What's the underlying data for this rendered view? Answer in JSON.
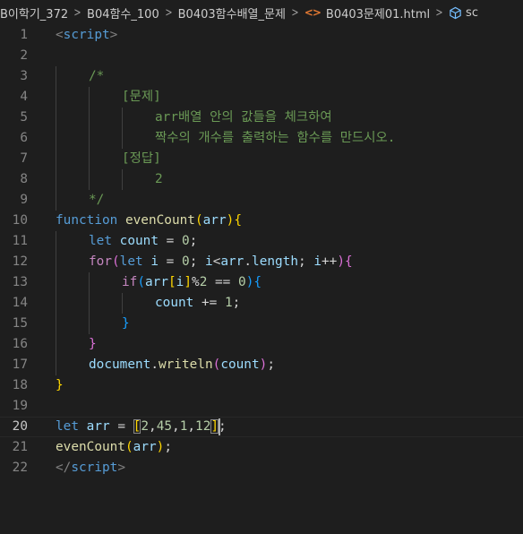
{
  "breadcrumb": [
    {
      "label": "B이학기_372",
      "icon": null
    },
    {
      "label": "B04함수_100",
      "icon": null
    },
    {
      "label": "B0403함수배열_문제",
      "icon": null
    },
    {
      "label": "B0403문제01.html",
      "icon": "html-icon",
      "icon_glyph": "<>"
    },
    {
      "label": "sc",
      "icon": "symbol-cube-icon"
    }
  ],
  "editor": {
    "current_line": 20,
    "lines": [
      {
        "n": 1,
        "indent": 0,
        "tokens": [
          [
            "tag",
            "<"
          ],
          [
            "tagname",
            "script"
          ],
          [
            "tag",
            ">"
          ]
        ]
      },
      {
        "n": 2,
        "indent": 0,
        "tokens": []
      },
      {
        "n": 3,
        "indent": 1,
        "tokens": [
          [
            "comment",
            "/*"
          ]
        ]
      },
      {
        "n": 4,
        "indent": 2,
        "tokens": [
          [
            "comment",
            "[문제]"
          ]
        ]
      },
      {
        "n": 5,
        "indent": 3,
        "tokens": [
          [
            "comment",
            "arr배열 안의 값들을 체크하여"
          ]
        ]
      },
      {
        "n": 6,
        "indent": 3,
        "tokens": [
          [
            "comment",
            "짝수의 개수를 출력하는 함수를 만드시오."
          ]
        ]
      },
      {
        "n": 7,
        "indent": 2,
        "tokens": [
          [
            "comment",
            "[정답]"
          ]
        ]
      },
      {
        "n": 8,
        "indent": 3,
        "tokens": [
          [
            "comment",
            "2"
          ]
        ]
      },
      {
        "n": 9,
        "indent": 1,
        "tokens": [
          [
            "comment",
            "*/"
          ]
        ]
      },
      {
        "n": 10,
        "indent": 0,
        "tokens": [
          [
            "kw",
            "function"
          ],
          [
            "op",
            " "
          ],
          [
            "fn",
            "evenCount"
          ],
          [
            "b1",
            "("
          ],
          [
            "var",
            "arr"
          ],
          [
            "b1",
            ")"
          ],
          [
            "b1",
            "{"
          ]
        ]
      },
      {
        "n": 11,
        "indent": 1,
        "tokens": [
          [
            "kw",
            "let"
          ],
          [
            "op",
            " "
          ],
          [
            "var",
            "count"
          ],
          [
            "op",
            " = "
          ],
          [
            "num",
            "0"
          ],
          [
            "op",
            ";"
          ]
        ]
      },
      {
        "n": 12,
        "indent": 1,
        "tokens": [
          [
            "ctrl",
            "for"
          ],
          [
            "b2",
            "("
          ],
          [
            "kw",
            "let"
          ],
          [
            "op",
            " "
          ],
          [
            "var",
            "i"
          ],
          [
            "op",
            " = "
          ],
          [
            "num",
            "0"
          ],
          [
            "op",
            "; "
          ],
          [
            "var",
            "i"
          ],
          [
            "op",
            "<"
          ],
          [
            "var",
            "arr"
          ],
          [
            "op",
            "."
          ],
          [
            "var",
            "length"
          ],
          [
            "op",
            "; "
          ],
          [
            "var",
            "i"
          ],
          [
            "op",
            "++"
          ],
          [
            "b2",
            ")"
          ],
          [
            "b2",
            "{"
          ]
        ]
      },
      {
        "n": 13,
        "indent": 2,
        "tokens": [
          [
            "ctrl",
            "if"
          ],
          [
            "b3",
            "("
          ],
          [
            "var",
            "arr"
          ],
          [
            "b1",
            "["
          ],
          [
            "var",
            "i"
          ],
          [
            "b1",
            "]"
          ],
          [
            "op",
            "%"
          ],
          [
            "num",
            "2"
          ],
          [
            "op",
            " == "
          ],
          [
            "num",
            "0"
          ],
          [
            "b3",
            ")"
          ],
          [
            "b3",
            "{"
          ]
        ]
      },
      {
        "n": 14,
        "indent": 3,
        "tokens": [
          [
            "var",
            "count"
          ],
          [
            "op",
            " += "
          ],
          [
            "num",
            "1"
          ],
          [
            "op",
            ";"
          ]
        ]
      },
      {
        "n": 15,
        "indent": 2,
        "tokens": [
          [
            "b3",
            "}"
          ]
        ]
      },
      {
        "n": 16,
        "indent": 1,
        "tokens": [
          [
            "b2",
            "}"
          ]
        ]
      },
      {
        "n": 17,
        "indent": 1,
        "tokens": [
          [
            "var",
            "document"
          ],
          [
            "op",
            "."
          ],
          [
            "fn",
            "writeln"
          ],
          [
            "b2",
            "("
          ],
          [
            "var",
            "count"
          ],
          [
            "b2",
            ")"
          ],
          [
            "op",
            ";"
          ]
        ]
      },
      {
        "n": 18,
        "indent": 0,
        "tokens": [
          [
            "b1",
            "}"
          ]
        ]
      },
      {
        "n": 19,
        "indent": 0,
        "tokens": []
      },
      {
        "n": 20,
        "indent": 0,
        "tokens": [
          [
            "kw",
            "let"
          ],
          [
            "op",
            " "
          ],
          [
            "var",
            "arr"
          ],
          [
            "op",
            " = "
          ],
          [
            "bm",
            "["
          ],
          [
            "num",
            "2"
          ],
          [
            "op",
            ","
          ],
          [
            "num",
            "45"
          ],
          [
            "op",
            ","
          ],
          [
            "num",
            "1"
          ],
          [
            "op",
            ","
          ],
          [
            "num",
            "12"
          ],
          [
            "bm",
            "]"
          ],
          [
            "op",
            ";"
          ]
        ]
      },
      {
        "n": 21,
        "indent": 0,
        "tokens": [
          [
            "fn",
            "evenCount"
          ],
          [
            "b1",
            "("
          ],
          [
            "var",
            "arr"
          ],
          [
            "b1",
            ")"
          ],
          [
            "op",
            ";"
          ]
        ]
      },
      {
        "n": 22,
        "indent": 0,
        "tokens": [
          [
            "tag",
            "</"
          ],
          [
            "tagname",
            "script"
          ],
          [
            "tag",
            ">"
          ]
        ]
      }
    ]
  },
  "colors": {
    "background": "#1e1e1e",
    "line_number": "#858585",
    "comment": "#6a9955",
    "keyword": "#569cd6",
    "control": "#c586c0",
    "function": "#dcdcaa",
    "variable": "#9cdcfe",
    "number": "#b5cea8",
    "bracket_1": "#ffd700",
    "bracket_2": "#da70d6",
    "bracket_3": "#179fff"
  }
}
